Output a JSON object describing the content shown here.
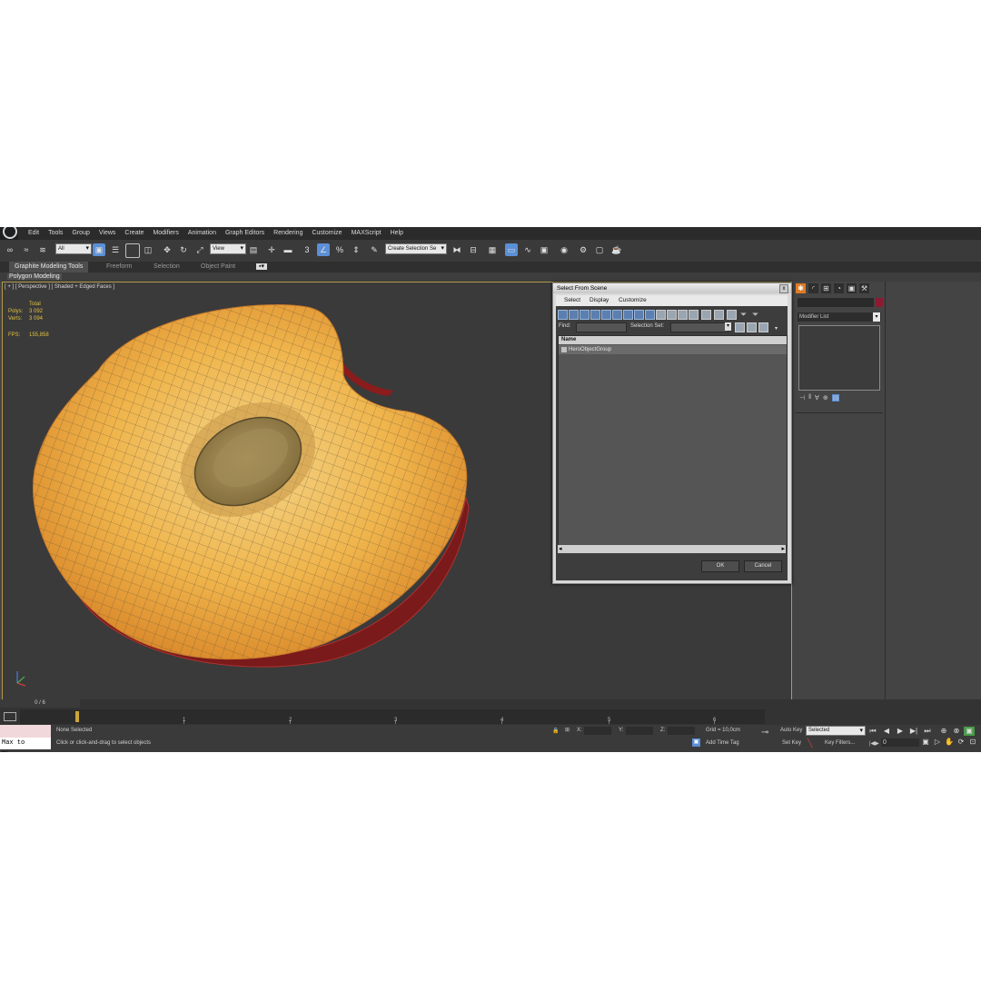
{
  "menu": [
    "Edit",
    "Tools",
    "Group",
    "Views",
    "Create",
    "Modifiers",
    "Animation",
    "Graph Editors",
    "Rendering",
    "Customize",
    "MAXScript",
    "Help"
  ],
  "toolbar": {
    "filter_value": "All",
    "ref_coord_value": "View",
    "selection_set_placeholder": "Create Selection Se"
  },
  "ribbon": {
    "tabs": [
      "Graphite Modeling Tools",
      "Freeform",
      "Selection",
      "Object Paint"
    ],
    "sub_tab": "Polygon Modeling"
  },
  "viewport": {
    "label": "[ + ] [ Perspective ] [ Shaded + Edged Faces ]",
    "stats_header": "Total",
    "polys_label": "Polys:",
    "polys_value": "3 092",
    "verts_label": "Verts:",
    "verts_value": "3 094",
    "fps_label": "FPS:",
    "fps_value": "155,858"
  },
  "dialog": {
    "title": "Select From Scene",
    "close_glyph": "x",
    "menu": [
      "Select",
      "Display",
      "Customize"
    ],
    "find_label": "Find:",
    "selection_set_label": "Selection Set:",
    "column_name": "Name",
    "rows": [
      "HeroObjectGroup"
    ],
    "ok_label": "OK",
    "cancel_label": "Cancel"
  },
  "right_panel": {
    "modifier_list": "Modifier List"
  },
  "timeline": {
    "frame_counter": "0 / 6",
    "ticks": [
      "1",
      "2",
      "3",
      "4",
      "5",
      "6"
    ]
  },
  "status": {
    "maxscript_text": "Max to Physc.",
    "selection_status": "None Selected",
    "prompt": "Click or click-and-drag to select objects",
    "x_label": "X:",
    "y_label": "Y:",
    "z_label": "Z:",
    "grid": "Grid = 10,0cm",
    "add_time_tag": "Add Time Tag",
    "auto_key": "Auto Key",
    "set_key": "Set Key",
    "selected_value": "Selected",
    "key_filters": "Key Filters...",
    "frame_value": "0"
  },
  "colors": {
    "accent_blue": "#5b8fd6",
    "viewport_border": "#b39c4c",
    "stats_yellow": "#e0c140",
    "object_swatch": "#8d1a31"
  }
}
